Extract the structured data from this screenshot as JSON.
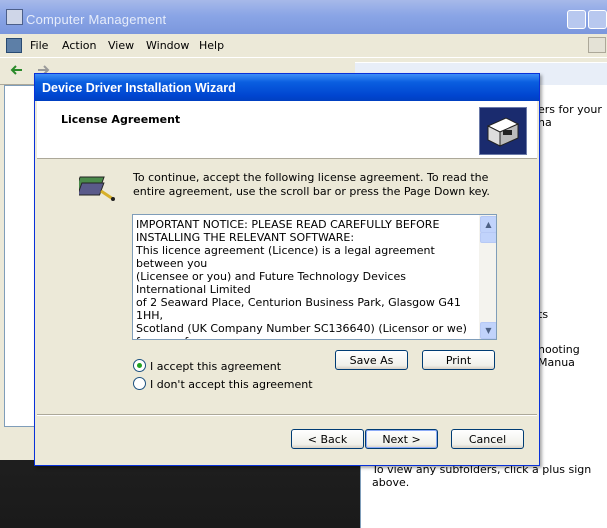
{
  "main_window": {
    "title": "Computer Management",
    "menu": [
      "File",
      "Action",
      "View",
      "Window",
      "Help"
    ],
    "right_pane_fragments": [
      "ers for your ha",
      "ts",
      "hooting Manua"
    ],
    "hint": "To view any subfolders, click a plus sign above."
  },
  "wizard": {
    "title": "Device Driver Installation Wizard",
    "header": "License Agreement",
    "intro": "To continue, accept the following license agreement. To read the entire agreement, use the scroll bar or press the Page Down key.",
    "license_text": "IMPORTANT NOTICE: PLEASE READ CAREFULLY BEFORE\nINSTALLING THE RELEVANT SOFTWARE:\nThis licence agreement (Licence) is a legal agreement between you\n(Licensee or you) and Future Technology Devices International Limited\nof 2 Seaward Place, Centurion Business Park, Glasgow G41 1HH,\nScotland (UK Company Number SC136640) (Licensor or we) for use of\ndriver software provided by the Licensor(Software).\n\nBY INSTALLING OR USING THIS SOFTWARE YOU AGREE TO THE",
    "radio_accept": "I accept this agreement",
    "radio_decline": "I don't accept this agreement",
    "accepted": true,
    "btn_save": "Save As",
    "btn_print": "Print",
    "btn_back": "< Back",
    "btn_next": "Next >",
    "btn_cancel": "Cancel"
  },
  "icons": [
    "computer-management-icon",
    "back-arrow-icon",
    "forward-arrow-icon",
    "folder-up-icon",
    "wizard-header-icon",
    "wizard-intro-icon",
    "scroll-up-icon",
    "scroll-down-icon"
  ]
}
